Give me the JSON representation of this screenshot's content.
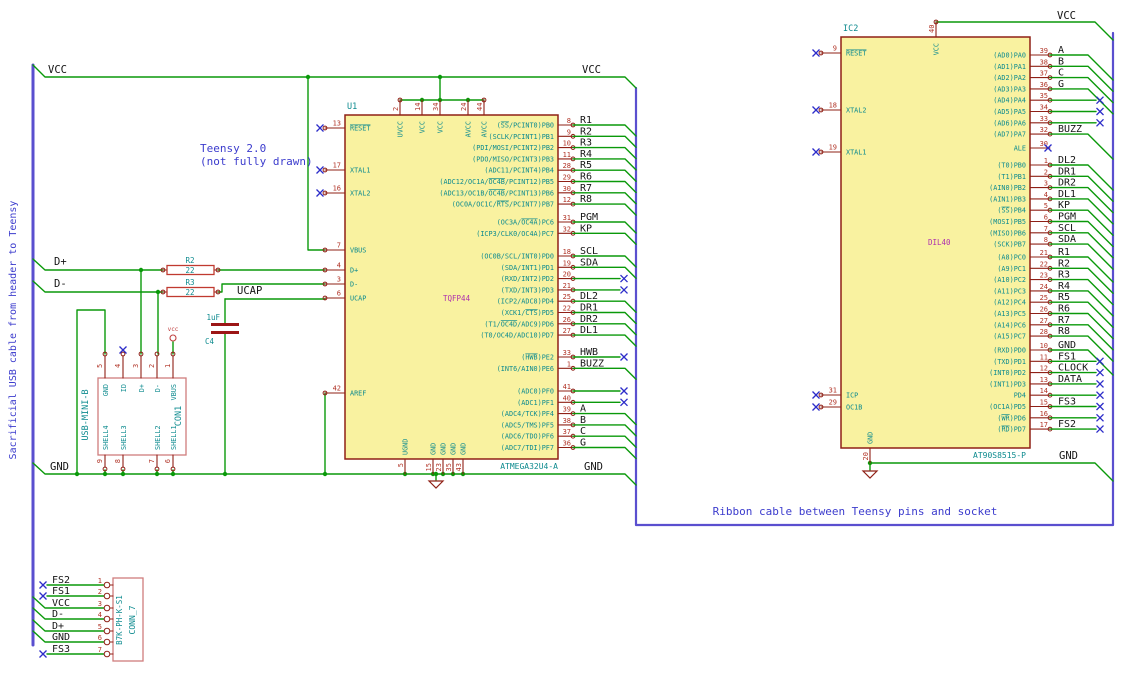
{
  "notes": {
    "cable_note": "Sacrificial USB cable from header to Teensy",
    "teensy_line1": "Teensy 2.0",
    "teensy_line2": "(not fully drawn)",
    "ribbon_note": "Ribbon cable between Teensy pins and socket"
  },
  "colors": {
    "wire": "#0a990a",
    "bus": "#5a4fcf",
    "note": "#3c3ccd",
    "no_connect": "#2d2dc9",
    "label": "#151515",
    "pin": "#8f2016",
    "pin_number": "#b03225",
    "pin_name": "#0e8b8f",
    "body_fill": "#f9f2a0",
    "reference": "#0e8b8f",
    "value": "#ae30ae",
    "connector_stroke": "#cf7d7d",
    "resistor_stroke": "#c03a30",
    "capacitor": "#9c1616",
    "power_flag": "#c04040"
  },
  "net_labels": {
    "left_vcc": "VCC",
    "mid_vcc": "VCC",
    "right_vcc": "VCC",
    "left_gnd": "GND",
    "mid_gnd": "GND",
    "right_gnd": "GND",
    "d_plus": "D+",
    "d_minus": "D-",
    "ucap": "UCAP",
    "vcc_flag": "vcc"
  },
  "u1": {
    "ref": "U1",
    "value": "TQFP44",
    "part": "ATMEGA32U4-A",
    "left_pins": [
      {
        "num": "13",
        "name": "~RESET~",
        "nc": true
      },
      {
        "num": "17",
        "name": "XTAL1",
        "nc": true
      },
      {
        "num": "16",
        "name": "XTAL2",
        "nc": true
      },
      {
        "num": "7",
        "name": "VBUS"
      },
      {
        "num": "4",
        "name": "D+"
      },
      {
        "num": "3",
        "name": "D-"
      },
      {
        "num": "6",
        "name": "UCAP"
      },
      {
        "num": "42",
        "name": "AREF"
      }
    ],
    "top_pins": [
      {
        "num": "2",
        "name": "UVCC"
      },
      {
        "num": "14",
        "name": "VCC"
      },
      {
        "num": "34",
        "name": "VCC"
      },
      {
        "num": "24",
        "name": "AVCC"
      },
      {
        "num": "44",
        "name": "AVCC"
      }
    ],
    "bottom_pins": [
      {
        "num": "5",
        "name": "UGND"
      },
      {
        "num": "15",
        "name": "GND"
      },
      {
        "num": "23",
        "name": "GND"
      },
      {
        "num": "35",
        "name": "GND"
      },
      {
        "num": "43",
        "name": "GND"
      }
    ],
    "right_groups": [
      [
        {
          "num": "8",
          "name": "(~SS~/PCINT0)PB0",
          "label": "R1"
        },
        {
          "num": "9",
          "name": "(SCLK/PCINT1)PB1",
          "label": "R2"
        },
        {
          "num": "10",
          "name": "(PDI/MOSI/PCINT2)PB2",
          "label": "R3"
        },
        {
          "num": "11",
          "name": "(PDO/MISO/PCINT3)PB3",
          "label": "R4"
        },
        {
          "num": "28",
          "name": "(ADC11/PCINT4)PB4",
          "label": "R5"
        },
        {
          "num": "29",
          "name": "(ADC12/OC1A/~OC4B~/PCINT12)PB5",
          "label": "R6"
        },
        {
          "num": "30",
          "name": "(ADC13/OC1B/~OC4B~/PCINT13)PB6",
          "label": "R7"
        },
        {
          "num": "12",
          "name": "(OC0A/OC1C/~RTS~/PCINT7)PB7",
          "label": "R8"
        }
      ],
      [
        {
          "num": "31",
          "name": "(OC3A/~OC4A~)PC6",
          "label": "PGM"
        },
        {
          "num": "32",
          "name": "(ICP3/CLK0/OC4A)PC7",
          "label": "KP"
        }
      ],
      [
        {
          "num": "18",
          "name": "(OC0B/SCL/INT0)PD0",
          "label": "SCL"
        },
        {
          "num": "19",
          "name": "(SDA/INT1)PD1",
          "label": "SDA"
        },
        {
          "num": "20",
          "name": "(RXD/INT2)PD2",
          "nc": true
        },
        {
          "num": "21",
          "name": "(TXD/INT3)PD3",
          "nc": true
        },
        {
          "num": "25",
          "name": "(ICP2/ADC8)PD4",
          "label": "DL2"
        },
        {
          "num": "22",
          "name": "(XCK1/~CTS~)PD5",
          "label": "DR1"
        },
        {
          "num": "26",
          "name": "(T1/~OC4D~/ADC9)PD6",
          "label": "DR2"
        },
        {
          "num": "27",
          "name": "(T0/OC4D/ADC10)PD7",
          "label": "DL1"
        }
      ],
      [
        {
          "num": "33",
          "name": "(~HWB~)PE2",
          "label": "HWB",
          "nc": true
        },
        {
          "num": "1",
          "name": "(INT6/AIN0)PE6",
          "label": "BUZZ"
        }
      ],
      [
        {
          "num": "41",
          "name": "(ADC0)PF0",
          "nc": true
        },
        {
          "num": "40",
          "name": "(ADC1)PF1",
          "nc": true
        },
        {
          "num": "39",
          "name": "(ADC4/TCK)PF4",
          "label": "A"
        },
        {
          "num": "38",
          "name": "(ADC5/TMS)PF5",
          "label": "B"
        },
        {
          "num": "37",
          "name": "(ADC6/TDO)PF6",
          "label": "C"
        },
        {
          "num": "36",
          "name": "(ADC7/TDI)PF7",
          "label": "G"
        }
      ]
    ]
  },
  "ic2": {
    "ref": "IC2",
    "value": "DIL40",
    "part": "AT90S8515-P",
    "left_pins": [
      {
        "num": "9",
        "name": "~RESET~",
        "nc": true
      },
      {
        "num": "18",
        "name": "XTAL2",
        "nc": true
      },
      {
        "num": "19",
        "name": "XTAL1",
        "nc": true
      },
      {
        "num": "31",
        "name": "ICP",
        "nc": true
      },
      {
        "num": "29",
        "name": "OC1B",
        "nc": true
      }
    ],
    "top_pins": [
      {
        "num": "40",
        "name": "VCC"
      }
    ],
    "bottom_pins": [
      {
        "num": "20",
        "name": "GND"
      }
    ],
    "right_groups": [
      [
        {
          "num": "39",
          "name": "(AD0)PA0",
          "label": "A"
        },
        {
          "num": "38",
          "name": "(AD1)PA1",
          "label": "B"
        },
        {
          "num": "37",
          "name": "(AD2)PA2",
          "label": "C"
        },
        {
          "num": "36",
          "name": "(AD3)PA3",
          "label": "G"
        },
        {
          "num": "35",
          "name": "(AD4)PA4",
          "nc": true
        },
        {
          "num": "34",
          "name": "(AD5)PA5",
          "nc": true
        },
        {
          "num": "33",
          "name": "(AD6)PA6",
          "nc": true
        },
        {
          "num": "32",
          "name": "(AD7)PA7",
          "label": "BUZZ"
        }
      ],
      [
        {
          "num": "30",
          "name": "ALE",
          "ncNear": true
        }
      ],
      [
        {
          "num": "1",
          "name": "(T0)PB0",
          "label": "DL2"
        },
        {
          "num": "2",
          "name": "(T1)PB1",
          "label": "DR1"
        },
        {
          "num": "3",
          "name": "(AIN0)PB2",
          "label": "DR2"
        },
        {
          "num": "4",
          "name": "(AIN1)PB3",
          "label": "DL1"
        },
        {
          "num": "5",
          "name": "(~SS~)PB4",
          "label": "KP"
        },
        {
          "num": "6",
          "name": "(MOSI)PB5",
          "label": "PGM"
        },
        {
          "num": "7",
          "name": "(MISO)PB6",
          "label": "SCL"
        },
        {
          "num": "8",
          "name": "(SCK)PB7",
          "label": "SDA"
        }
      ],
      [
        {
          "num": "21",
          "name": "(A8)PC0",
          "label": "R1"
        },
        {
          "num": "22",
          "name": "(A9)PC1",
          "label": "R2"
        },
        {
          "num": "23",
          "name": "(A10)PC2",
          "label": "R3"
        },
        {
          "num": "24",
          "name": "(A11)PC3",
          "label": "R4"
        },
        {
          "num": "25",
          "name": "(A12)PC4",
          "label": "R5"
        },
        {
          "num": "26",
          "name": "(A13)PC5",
          "label": "R6"
        },
        {
          "num": "27",
          "name": "(A14)PC6",
          "label": "R7"
        },
        {
          "num": "28",
          "name": "(A15)PC7",
          "label": "R8"
        }
      ],
      [
        {
          "num": "10",
          "name": "(RXD)PD0",
          "label": "GND"
        },
        {
          "num": "11",
          "name": "(TXD)PD1",
          "label": "FS1",
          "nc": true
        },
        {
          "num": "12",
          "name": "(INT0)PD2",
          "label": "CLOCK",
          "nc": true
        },
        {
          "num": "13",
          "name": "(INT1)PD3",
          "label": "DATA",
          "nc": true
        },
        {
          "num": "14",
          "name": "PD4",
          "nc": true
        },
        {
          "num": "15",
          "name": "(OC1A)PD5",
          "label": "FS3",
          "nc": true
        },
        {
          "num": "16",
          "name": "(~WR~)PD6",
          "nc": true
        },
        {
          "num": "17",
          "name": "(~RD~)PD7",
          "label": "FS2",
          "nc": true
        }
      ]
    ]
  },
  "r2": {
    "ref": "R2",
    "value": "22"
  },
  "r3": {
    "ref": "R3",
    "value": "22"
  },
  "c4": {
    "ref": "C4",
    "value": "1uF"
  },
  "con1": {
    "ref": "CON1",
    "name": "USB-MINI-B",
    "top_pins": [
      {
        "num": "5",
        "name": "GND"
      },
      {
        "num": "4",
        "name": "ID",
        "nc": true
      },
      {
        "num": "3",
        "name": "D+"
      },
      {
        "num": "2",
        "name": "D-"
      },
      {
        "num": "1",
        "name": "VBUS"
      }
    ],
    "shell_pins": [
      {
        "num": "9",
        "name": "SHELL4"
      },
      {
        "num": "8",
        "name": "SHELL3"
      },
      {
        "num": "7",
        "name": "SHELL2"
      },
      {
        "num": "6",
        "name": "SHELL1"
      }
    ]
  },
  "conn7": {
    "ref": "CONN_7",
    "name": "B7K-PH-K-S1",
    "rows": [
      {
        "num": "1",
        "label": "FS2",
        "nc": true
      },
      {
        "num": "2",
        "label": "FS1",
        "nc": true
      },
      {
        "num": "3",
        "label": "VCC"
      },
      {
        "num": "4",
        "label": "D-"
      },
      {
        "num": "5",
        "label": "D+"
      },
      {
        "num": "6",
        "label": "GND"
      },
      {
        "num": "7",
        "label": "FS3",
        "nc": true
      }
    ]
  }
}
